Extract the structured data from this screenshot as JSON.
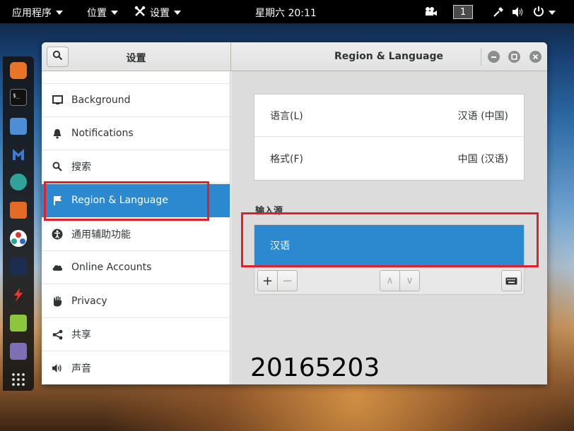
{
  "topbar": {
    "apps_menu": "应用程序",
    "places_menu": "位置",
    "settings_menu": "设置",
    "clock": "星期六 20:11",
    "workspace": "1"
  },
  "window": {
    "sidebar_title": "设置",
    "title": "Region & Language"
  },
  "sidebar": {
    "items": [
      {
        "label": "Background",
        "icon": "background-icon"
      },
      {
        "label": "Notifications",
        "icon": "bell-icon"
      },
      {
        "label": "搜索",
        "icon": "search-icon"
      },
      {
        "label": "Region & Language",
        "icon": "flag-icon",
        "active": true
      },
      {
        "label": "通用辅助功能",
        "icon": "accessibility-icon"
      },
      {
        "label": "Online Accounts",
        "icon": "cloud-icon"
      },
      {
        "label": "Privacy",
        "icon": "hand-icon"
      },
      {
        "label": "共享",
        "icon": "share-icon"
      },
      {
        "label": "声音",
        "icon": "speaker-icon"
      }
    ]
  },
  "region": {
    "language_label": "语言(L)",
    "language_value": "汉语 (中国)",
    "formats_label": "格式(F)",
    "formats_value": "中国 (汉语)",
    "input_sources_title": "输入源",
    "input_sources": [
      "汉语"
    ]
  },
  "toolbar": {
    "add": "+",
    "remove": "−",
    "up": "∧",
    "down": "∨"
  },
  "annotation": {
    "student_id": "20165203",
    "highlight_color": "#e0212b"
  },
  "colors": {
    "accent": "#2c89cf",
    "topbar": "#000000"
  }
}
